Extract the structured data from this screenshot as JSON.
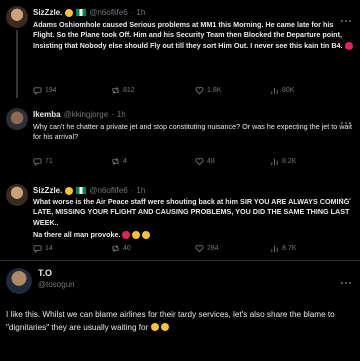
{
  "posts": [
    {
      "name": "SizZzle.",
      "handle": "@n6oflife6",
      "dot": "·",
      "time": "1h",
      "text": "Adams Oshiomhole caused Serious problems at MM1 this Morning. He came late for his Flight. So the Plane took Off. Him and his Security Team then Blocked the Departure point, Insisting that Nobody else should Fly out till they sort Him Out. I never see this kain tin B4.",
      "replies": "194",
      "reposts": "812",
      "likes": "1.8K",
      "views": "80K"
    },
    {
      "name": "Ikemba",
      "handle": "@kkingjorge",
      "dot": "·",
      "time": "1h",
      "text": "Why can't he chatter a private jet and stop constituting nuisance? Or was he expecting the jet to wait for his arrival?",
      "replies": "71",
      "reposts": "4",
      "likes": "48",
      "views": "8.2K"
    },
    {
      "name": "SizZzle.",
      "handle": "@n6oflife6",
      "dot": "·",
      "time": "1h",
      "text": "What worse is the Air Peace staff were shouting back at him SIR YOU ARE ALWAYS COMING LATE, MISSING YOUR FLIGHT AND CAUSING PROBLEMS, YOU DID THE SAME THING LAST WEEK..",
      "text2": "Na there all man provoke.",
      "replies": "14",
      "reposts": "40",
      "likes": "284",
      "views": "8.7K"
    },
    {
      "name": "T.O",
      "handle": "@tosogun",
      "text": "I like this. Whilst we can blame airlines for their tardy services,  let's also share the blame to \"dignitaries\" they are usually waiting for"
    }
  ],
  "icons": {
    "reply": "reply-icon",
    "repost": "repost-icon",
    "like": "heart-icon",
    "views": "views-icon",
    "more": "more-icon"
  }
}
